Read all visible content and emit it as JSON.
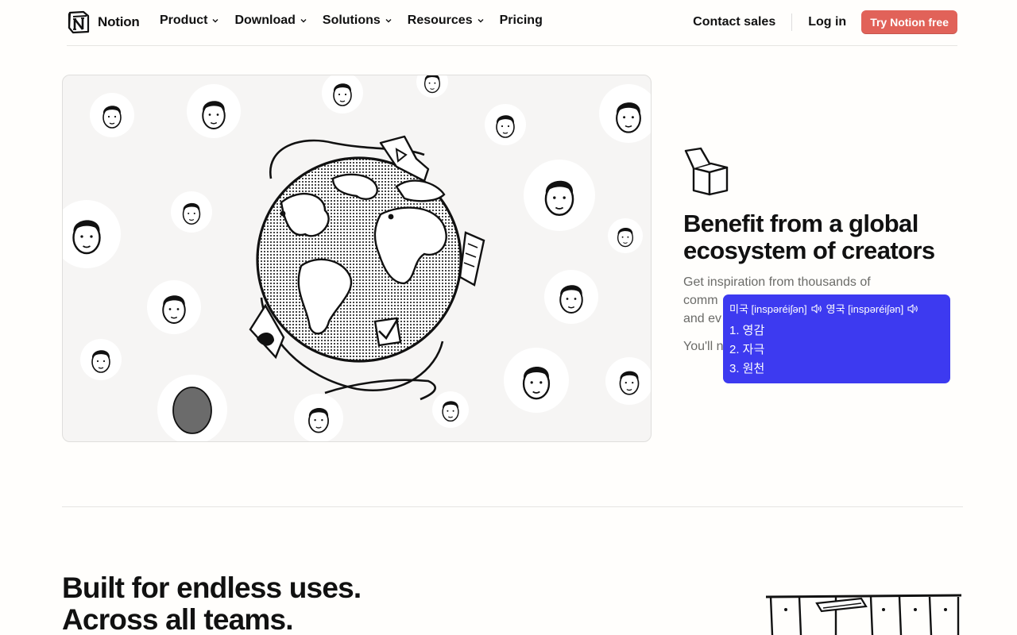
{
  "nav": {
    "logo_text": "Notion",
    "menu": [
      {
        "label": "Product",
        "has_dropdown": true
      },
      {
        "label": "Download",
        "has_dropdown": true
      },
      {
        "label": "Solutions",
        "has_dropdown": true
      },
      {
        "label": "Resources",
        "has_dropdown": true
      },
      {
        "label": "Pricing",
        "has_dropdown": false
      }
    ],
    "contact_sales": "Contact sales",
    "login": "Log in",
    "cta": "Try Notion free"
  },
  "feature": {
    "icon": "open-box-icon",
    "title_line1": "Benefit from a global",
    "title_line2": "ecosystem of creators",
    "desc_line1": "Get inspiration from thousands of",
    "desc_line2": "comm",
    "desc_line3": "and ev",
    "more": "You'll n"
  },
  "dictionary_popup": {
    "us_label": "미국 [inspəréiʃən]",
    "uk_label": "영국 [inspəréiʃən]",
    "meanings": [
      "1. 영감",
      "2. 자극",
      "3. 원천"
    ]
  },
  "section": {
    "heading_line1": "Built for endless uses.",
    "heading_line2": "Across all teams."
  },
  "colors": {
    "cta": "#e16259",
    "popup": "#3d3af0",
    "page_bg": "#fffefc",
    "panel_bg": "#f6f5f4"
  }
}
